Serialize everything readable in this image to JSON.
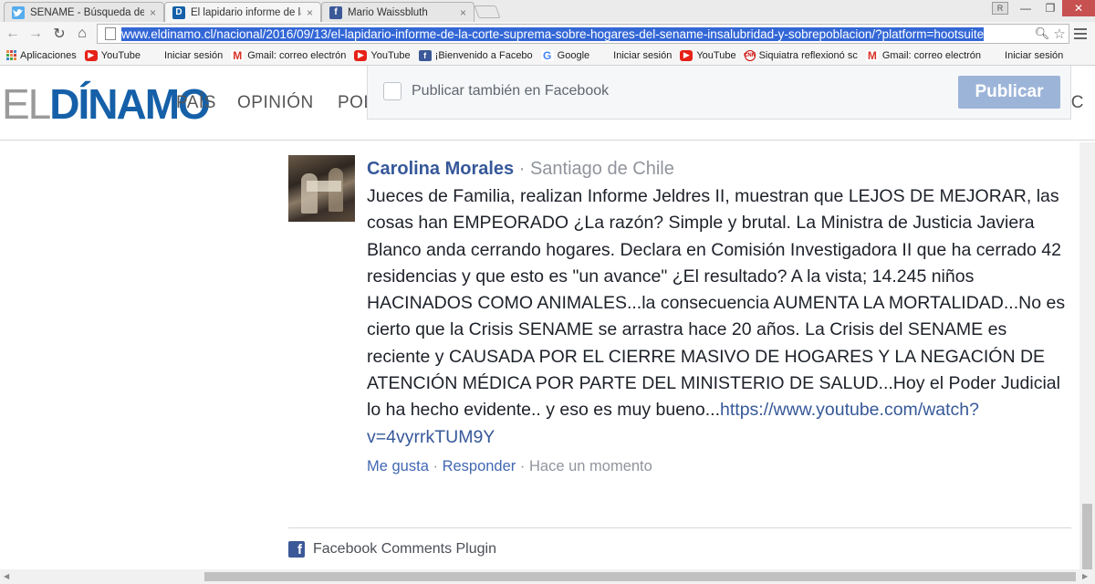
{
  "browser": {
    "tabs": [
      {
        "title": "SENAME - Búsqueda de T",
        "icon": "twitter-icon"
      },
      {
        "title": "El lapidario informe de la",
        "icon": "eldinamo-icon",
        "badge": "D"
      },
      {
        "title": "Mario Waissbluth",
        "icon": "facebook-icon",
        "badge": "f"
      }
    ],
    "profile_initial": "R",
    "url_text": "www.eldinamo.cl/nacional/2016/09/13/el-lapidario-informe-de-la-corte-suprema-sobre-hogares-del-sename-insalubridad-y-sobrepoblacion/?platform=hootsuite",
    "bookmarks": [
      {
        "label": "Aplicaciones",
        "icon": "apps"
      },
      {
        "label": "YouTube",
        "icon": "yt"
      },
      {
        "label": "Iniciar sesión",
        "icon": "ms"
      },
      {
        "label": "Gmail: correo electrón",
        "icon": "gm"
      },
      {
        "label": "YouTube",
        "icon": "yt"
      },
      {
        "label": "¡Bienvenido a Facebo",
        "icon": "fb"
      },
      {
        "label": "Google",
        "icon": "gg"
      },
      {
        "label": "Iniciar sesión",
        "icon": "ms"
      },
      {
        "label": "YouTube",
        "icon": "yt"
      },
      {
        "label": "Siquiatra reflexionó sc",
        "icon": "cnn"
      },
      {
        "label": "Gmail: correo electrón",
        "icon": "gm"
      },
      {
        "label": "Iniciar sesión",
        "icon": "ms"
      }
    ]
  },
  "site": {
    "logo_prefix": "EL",
    "logo_main": "DÍNAMO",
    "nav": [
      "PAÍS",
      "OPINIÓN",
      "POL"
    ],
    "nav_right_fragment": "IC",
    "colors": {
      "logo_blue": "#1560a8",
      "fb_link": "#365899"
    }
  },
  "fb_popup": {
    "checkbox_label": "Publicar también en Facebook",
    "publish_button": "Publicar"
  },
  "comment": {
    "author": "Carolina Morales",
    "separator": "·",
    "location": "Santiago de Chile",
    "text": "Jueces de Familia, realizan Informe Jeldres II, muestran que LEJOS DE MEJORAR, las cosas han EMPEORADO ¿La razón? Simple y brutal. La Ministra de Justicia Javiera Blanco anda cerrando hogares. Declara en Comisión Investigadora II que ha cerrado 42 residencias y que esto es \"un avance\" ¿El resultado? A la vista; 14.245 niños HACINADOS COMO ANIMALES...la consecuencia AUMENTA LA MORTALIDAD...No es cierto que la Crisis SENAME se arrastra hace 20 años. La Crisis del SENAME es reciente y CAUSADA POR EL CIERRE MASIVO DE HOGARES Y LA NEGACIÓN DE ATENCIÓN MÉDICA POR PARTE DEL MINISTERIO DE SALUD...Hoy el Poder Judicial lo ha hecho evidente.. y eso es muy bueno...",
    "link": "https://www.youtube.com/watch?v=4vyrrkTUM9Y",
    "like": "Me gusta",
    "reply": "Responder",
    "time": "Hace un momento"
  },
  "plugin": {
    "label": "Facebook Comments Plugin"
  }
}
